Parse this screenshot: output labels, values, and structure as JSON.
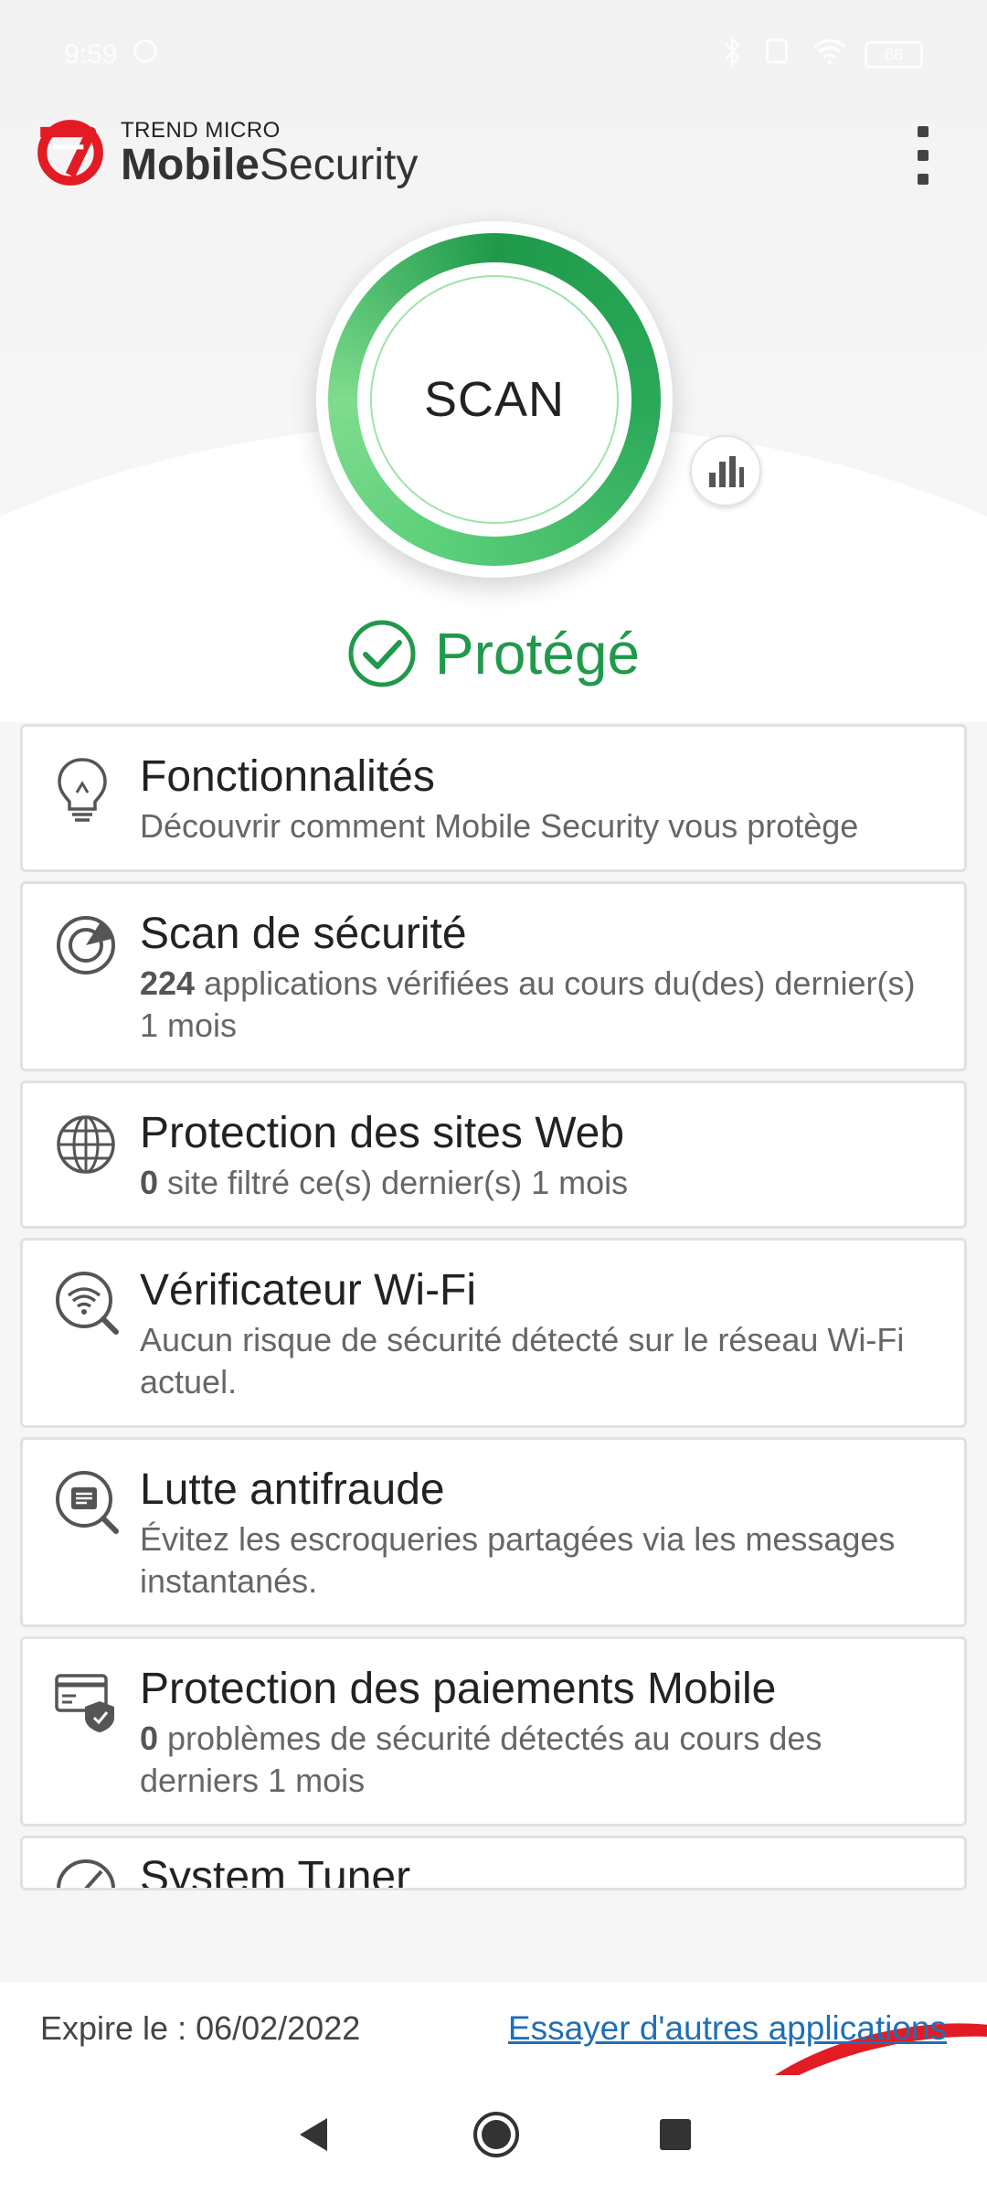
{
  "status_bar": {
    "time": "9:59",
    "battery": "68"
  },
  "app": {
    "brand_top": "TREND MICRO",
    "brand_bold": "Mobile",
    "brand_light": "Security"
  },
  "scan": {
    "label": "SCAN"
  },
  "protection_status": "Protégé",
  "cards": [
    {
      "title": "Fonctionnalités",
      "desc_text": "Découvrir comment Mobile Security vous protège"
    },
    {
      "title": "Scan de sécurité",
      "desc_num": "224",
      "desc_text": " applications vérifiées au cours du(des) dernier(s) 1 mois"
    },
    {
      "title": "Protection des sites Web",
      "desc_num": "0",
      "desc_text": " site filtré ce(s) dernier(s) 1 mois"
    },
    {
      "title": "Vérificateur Wi-Fi",
      "desc_text": "Aucun risque de sécurité détecté sur le réseau Wi-Fi actuel."
    },
    {
      "title": "Lutte antifraude",
      "desc_text": "Évitez les escroqueries partagées via les messages instantanés."
    },
    {
      "title": "Protection des paiements Mobile",
      "desc_num": "0",
      "desc_text": " problèmes de sécurité détectés au cours des derniers 1 mois"
    },
    {
      "title": "System Tuner"
    }
  ],
  "footer": {
    "expire": "Expire le : 06/02/2022",
    "link": "Essayer d'autres applications"
  },
  "colors": {
    "accent_green": "#21994b",
    "brand_red": "#e31b23",
    "link_blue": "#1f6fb5"
  }
}
